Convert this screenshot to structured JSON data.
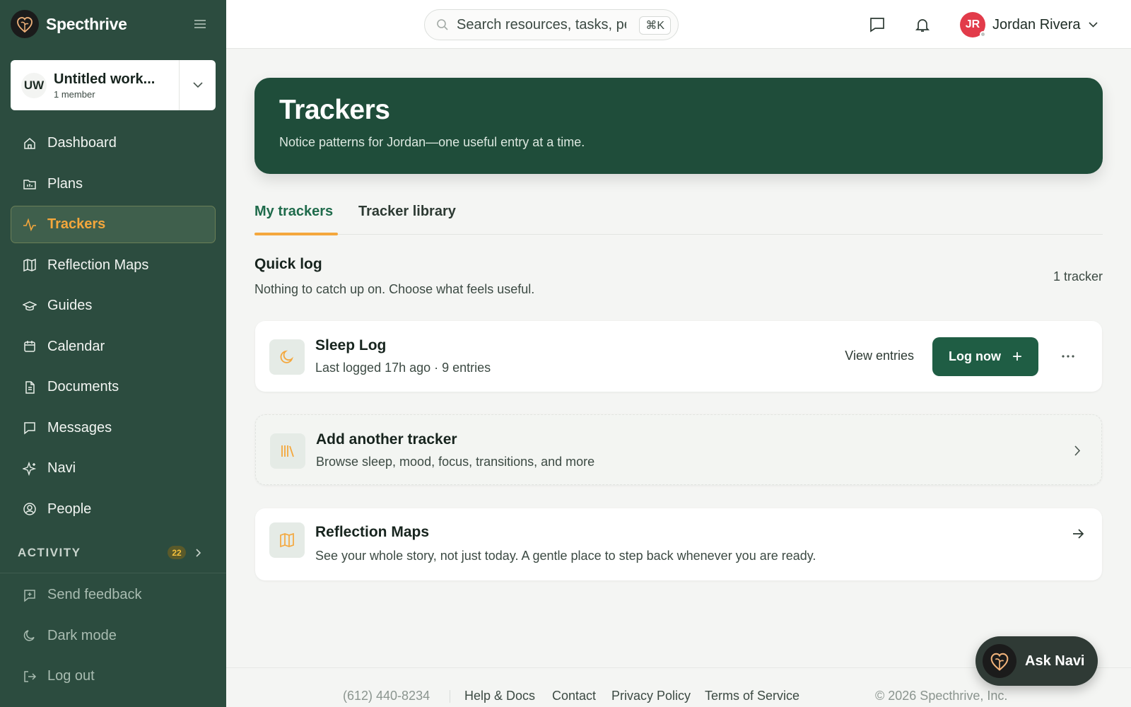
{
  "brand": {
    "name": "Specthrive"
  },
  "workspace": {
    "initials": "UW",
    "name": "Untitled work...",
    "members": "1 member"
  },
  "sidebar": {
    "items": [
      {
        "label": "Dashboard",
        "icon": "home-icon"
      },
      {
        "label": "Plans",
        "icon": "folder-chart-icon"
      },
      {
        "label": "Trackers",
        "icon": "activity-icon",
        "active": true
      },
      {
        "label": "Reflection Maps",
        "icon": "map-icon"
      },
      {
        "label": "Guides",
        "icon": "graduation-cap-icon"
      },
      {
        "label": "Calendar",
        "icon": "calendar-icon"
      },
      {
        "label": "Documents",
        "icon": "document-icon"
      },
      {
        "label": "Messages",
        "icon": "message-icon"
      },
      {
        "label": "Navi",
        "icon": "sparkle-icon"
      },
      {
        "label": "People",
        "icon": "user-circle-icon"
      }
    ],
    "activity": {
      "label": "ACTIVITY",
      "count": "22"
    },
    "bottom": [
      {
        "label": "Send feedback",
        "icon": "feedback-icon"
      },
      {
        "label": "Dark mode",
        "icon": "moon-icon"
      },
      {
        "label": "Log out",
        "icon": "logout-icon"
      }
    ]
  },
  "topbar": {
    "search_placeholder": "Search resources, tasks, people...",
    "shortcut": "⌘K",
    "user": {
      "initials": "JR",
      "name": "Jordan Rivera"
    }
  },
  "hero": {
    "title": "Trackers",
    "subtitle": "Notice patterns for Jordan—one useful entry at a time."
  },
  "tabs": [
    {
      "label": "My trackers",
      "active": true
    },
    {
      "label": "Tracker library"
    }
  ],
  "quick_log": {
    "title": "Quick log",
    "subtitle": "Nothing to catch up on. Choose what feels useful.",
    "count": "1 tracker"
  },
  "cards": {
    "sleep": {
      "title": "Sleep Log",
      "subtitle": "Last logged 17h ago · 9 entries",
      "view_label": "View entries",
      "log_label": "Log now"
    },
    "add": {
      "title": "Add another tracker",
      "subtitle": "Browse sleep, mood, focus, transitions, and more"
    },
    "maps": {
      "title": "Reflection Maps",
      "subtitle": "See your whole story, not just today. A gentle place to step back whenever you are ready."
    }
  },
  "footer": {
    "phone": "(612) 440-8234",
    "links": [
      "Help & Docs",
      "Contact",
      "Privacy Policy",
      "Terms of Service"
    ],
    "copyright": "© 2026 Specthrive, Inc."
  },
  "ask_navi": {
    "label": "Ask Navi"
  },
  "colors": {
    "sidebar": "#2c4c3f",
    "hero": "#1f4d3a",
    "accent": "#f4a73c",
    "primary_button": "#1f5d44",
    "avatar": "#e23b4a"
  }
}
